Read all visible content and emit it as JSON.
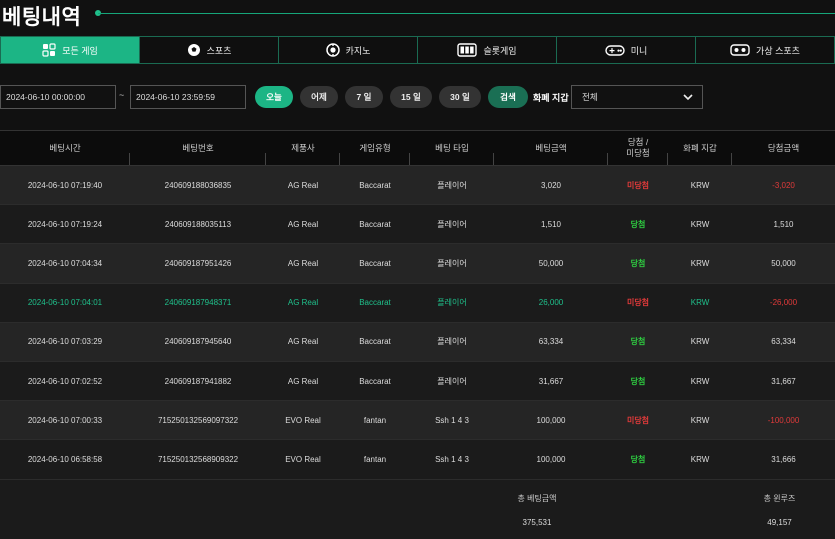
{
  "page": {
    "title": "베팅내역"
  },
  "tabs": [
    {
      "label": "모든 게임",
      "icon": "grid-icon"
    },
    {
      "label": "스포츠",
      "icon": "soccer-ball-icon"
    },
    {
      "label": "카지노",
      "icon": "casino-chip-icon"
    },
    {
      "label": "슬롯게임",
      "icon": "slot-machine-icon"
    },
    {
      "label": "미니",
      "icon": "gamepad-icon"
    },
    {
      "label": "가상 스포츠",
      "icon": "virtual-sports-icon"
    }
  ],
  "filters": {
    "start_date": "2024-06-10 00:00:00",
    "separator": "~",
    "end_date": "2024-06-10 23:59:59",
    "quick": [
      "오늘",
      "어제",
      "7 일",
      "15 일",
      "30 일"
    ],
    "search_label": "검색",
    "currency_label": "화폐 지갑",
    "currency_value": "전체"
  },
  "table": {
    "headers": [
      "베팅시간",
      "베팅번호",
      "제품사",
      "게임유형",
      "베팅 타입",
      "베팅금액",
      "당첨 /\n미당첨",
      "화폐 지갑",
      "당첨금액"
    ],
    "rows": [
      {
        "time": "2024-06-10 07:19:40",
        "id": "240609188036835",
        "vendor": "AG Real",
        "game": "Baccarat",
        "type": "플레이어",
        "amount": "3,020",
        "result": "미당첨",
        "wallet": "KRW",
        "payout": "-3,020"
      },
      {
        "time": "2024-06-10 07:19:24",
        "id": "240609188035113",
        "vendor": "AG Real",
        "game": "Baccarat",
        "type": "플레이어",
        "amount": "1,510",
        "result": "당첨",
        "wallet": "KRW",
        "payout": "1,510"
      },
      {
        "time": "2024-06-10 07:04:34",
        "id": "240609187951426",
        "vendor": "AG Real",
        "game": "Baccarat",
        "type": "플레이어",
        "amount": "50,000",
        "result": "당첨",
        "wallet": "KRW",
        "payout": "50,000"
      },
      {
        "time": "2024-06-10 07:04:01",
        "id": "240609187948371",
        "vendor": "AG Real",
        "game": "Baccarat",
        "type": "플레이어",
        "amount": "26,000",
        "result": "미당첨",
        "wallet": "KRW",
        "payout": "-26,000"
      },
      {
        "time": "2024-06-10 07:03:29",
        "id": "240609187945640",
        "vendor": "AG Real",
        "game": "Baccarat",
        "type": "플레이어",
        "amount": "63,334",
        "result": "당첨",
        "wallet": "KRW",
        "payout": "63,334"
      },
      {
        "time": "2024-06-10 07:02:52",
        "id": "240609187941882",
        "vendor": "AG Real",
        "game": "Baccarat",
        "type": "플레이어",
        "amount": "31,667",
        "result": "당첨",
        "wallet": "KRW",
        "payout": "31,667"
      },
      {
        "time": "2024-06-10 07:00:33",
        "id": "715250132569097322",
        "vendor": "EVO Real",
        "game": "fantan",
        "type": "Ssh 1 4 3",
        "amount": "100,000",
        "result": "미당첨",
        "wallet": "KRW",
        "payout": "-100,000"
      },
      {
        "time": "2024-06-10 06:58:58",
        "id": "715250132568909322",
        "vendor": "EVO Real",
        "game": "fantan",
        "type": "Ssh 1 4 3",
        "amount": "100,000",
        "result": "당첨",
        "wallet": "KRW",
        "payout": "31,666"
      }
    ]
  },
  "summary": {
    "total_bet_label": "총 베팅금액",
    "total_bet_value": "375,531",
    "total_winloss_label": "총 윈루즈",
    "total_winloss_value": "49,157"
  },
  "colors": {
    "accent": "#1cb585",
    "win": "#2ecc40",
    "lose": "#e03a3a",
    "highlight_row_text": "#1fc08b"
  }
}
